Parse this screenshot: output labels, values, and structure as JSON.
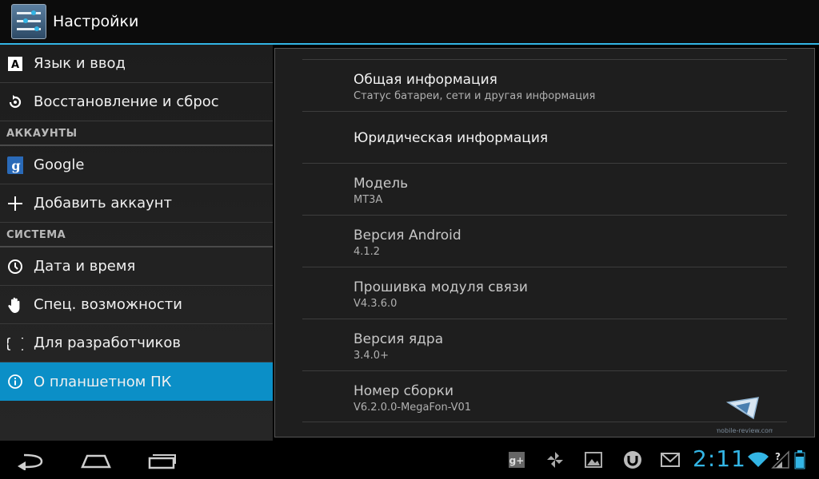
{
  "actionbar": {
    "title": "Настройки",
    "icon": "settings-sliders-icon"
  },
  "sidebar": {
    "rows": [
      {
        "type": "item",
        "label": "Язык и ввод",
        "icon": "keyboard-a-icon"
      },
      {
        "type": "item",
        "label": "Восстановление и сброс",
        "icon": "backup-restore-icon"
      },
      {
        "type": "section",
        "label": "АККАУНТЫ"
      },
      {
        "type": "item",
        "label": "Google",
        "icon": "google-account-icon"
      },
      {
        "type": "item",
        "label": "Добавить аккаунт",
        "icon": "plus-icon"
      },
      {
        "type": "section",
        "label": "СИСТЕМА"
      },
      {
        "type": "item",
        "label": "Дата и время",
        "icon": "clock-icon"
      },
      {
        "type": "item",
        "label": "Спец. возможности",
        "icon": "hand-icon"
      },
      {
        "type": "item",
        "label": "Для разработчиков",
        "icon": "braces-icon"
      },
      {
        "type": "item",
        "label": "О планшетном ПК",
        "icon": "info-icon",
        "selected": true
      }
    ]
  },
  "details": {
    "items": [
      {
        "title": "Общая информация",
        "summary": "Статус батареи, сети и другая информация",
        "clickable": true
      },
      {
        "title": "Юридическая информация",
        "summary": "",
        "clickable": true
      },
      {
        "title": "Модель",
        "summary": "MT3A",
        "clickable": false
      },
      {
        "title": "Версия Android",
        "summary": "4.1.2",
        "clickable": false
      },
      {
        "title": "Прошивка модуля связи",
        "summary": "V4.3.6.0",
        "clickable": false
      },
      {
        "title": "Версия ядра",
        "summary": "3.4.0+",
        "clickable": false
      },
      {
        "title": "Номер сборки",
        "summary": "V6.2.0.0-MegaFon-V01",
        "clickable": false
      }
    ]
  },
  "watermark": {
    "text": "mobile-review.com"
  },
  "systembar": {
    "clock": "2:11",
    "notifications": [
      "google-plus-icon",
      "pinwheel-icon",
      "gallery-icon",
      "utorrent-icon",
      "gmail-icon"
    ],
    "status": [
      "wifi-icon",
      "cell-signal-icon",
      "battery-icon"
    ],
    "nav": [
      "back-icon",
      "home-icon",
      "recent-apps-icon"
    ],
    "accent_color": "#33b5e5",
    "selected_color": "#0b8fc7"
  }
}
